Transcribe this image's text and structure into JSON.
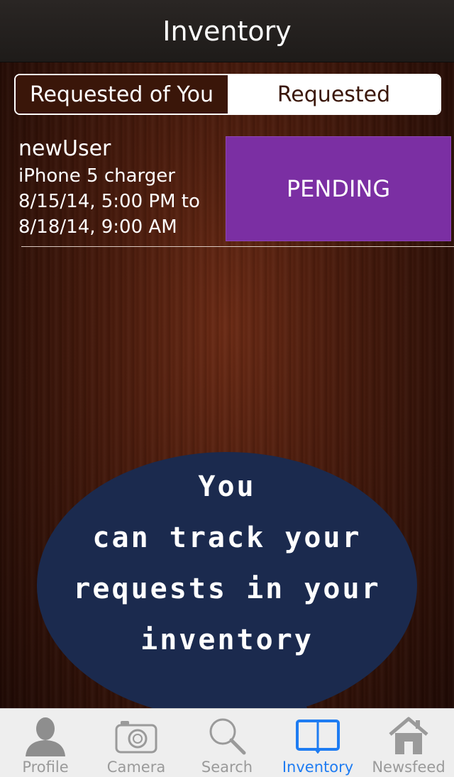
{
  "header": {
    "title": "Inventory"
  },
  "segmented": {
    "left_label": "Requested of You",
    "right_label": "Requested"
  },
  "request": {
    "user": "newUser",
    "item": "iPhone 5 charger",
    "date_line1": "8/15/14, 5:00 PM to",
    "date_line2": "8/18/14, 9:00 AM",
    "status": "PENDING",
    "status_color": "#7b2fa3"
  },
  "tip": {
    "line1": "You",
    "line2": "can track your",
    "line3": "requests in your",
    "line4": "inventory",
    "bubble_color": "#1b2a4e"
  },
  "tabs": [
    {
      "label": "Profile",
      "icon": "person-icon",
      "active": false
    },
    {
      "label": "Camera",
      "icon": "camera-icon",
      "active": false
    },
    {
      "label": "Search",
      "icon": "magnifier-icon",
      "active": false
    },
    {
      "label": "Inventory",
      "icon": "book-icon",
      "active": true
    },
    {
      "label": "Newsfeed",
      "icon": "home-icon",
      "active": false
    }
  ],
  "colors": {
    "accent": "#1e7cf2",
    "inactive_tab": "#9a9a9a"
  }
}
